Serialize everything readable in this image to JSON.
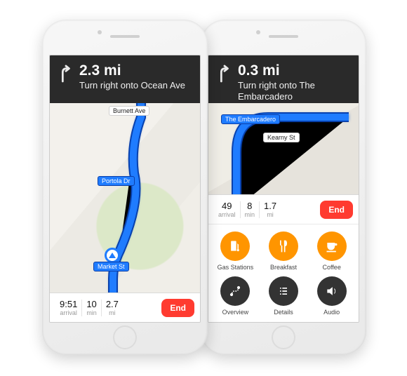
{
  "phone1": {
    "banner": {
      "distance": "2.3 mi",
      "instruction": "Turn right onto Ocean Ave",
      "turn_icon": "turn-right-icon"
    },
    "map_labels": {
      "burnett": "Burnett Ave",
      "portola": "Portola Dr",
      "market": "Market St"
    },
    "stats": {
      "arrival_value": "9:51",
      "arrival_unit": "arrival",
      "time_value": "10",
      "time_unit": "min",
      "dist_value": "2.7",
      "dist_unit": "mi"
    },
    "end_label": "End"
  },
  "phone2": {
    "banner": {
      "distance": "0.3 mi",
      "instruction": "Turn right onto The Embarcadero",
      "turn_icon": "turn-right-icon"
    },
    "map_labels": {
      "embarcadero": "The Embarcadero",
      "kearny": "Kearny St"
    },
    "stats": {
      "arrival_value": "49",
      "arrival_unit": "arrival",
      "time_value": "8",
      "time_unit": "min",
      "dist_value": "1.7",
      "dist_unit": "mi"
    },
    "end_label": "End",
    "menu": {
      "gas": "Gas Stations",
      "breakfast": "Breakfast",
      "coffee": "Coffee",
      "overview": "Overview",
      "details": "Details",
      "audio": "Audio"
    }
  },
  "colors": {
    "accent_orange": "#ff9500",
    "accent_red": "#ff3b30",
    "route_blue": "#1f7cff"
  }
}
